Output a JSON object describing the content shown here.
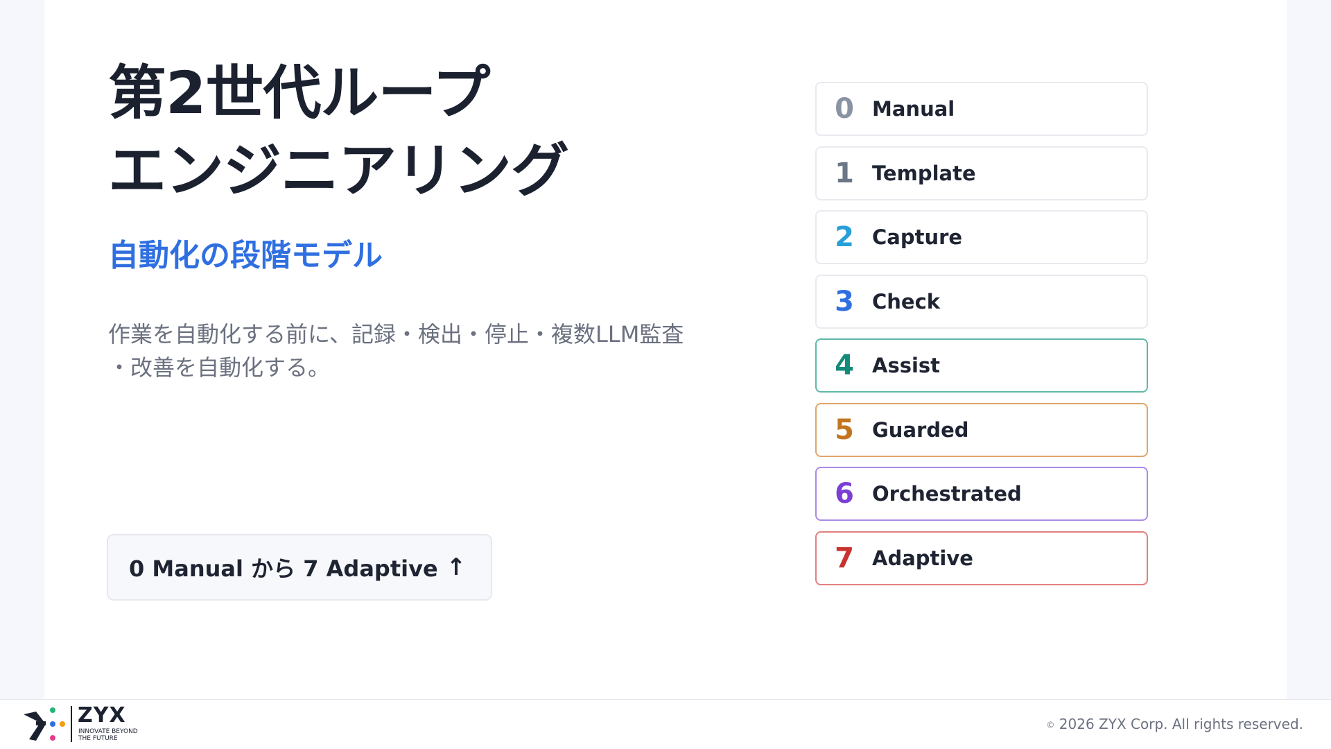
{
  "title": {
    "line1": "第2世代ループ",
    "line2": "エンジニアリング"
  },
  "subtitle": "自動化の段階モデル",
  "description": {
    "line1": "作業を自動化する前に、記録・検出・停止・複数LLM監査",
    "line2": "・改善を自動化する。"
  },
  "pill": {
    "text": "0 Manual から 7 Adaptive",
    "arrow": "↑"
  },
  "stages": [
    {
      "num": "0",
      "label": "Manual",
      "num_color": "#8a93a3",
      "border": "#e8eaef"
    },
    {
      "num": "1",
      "label": "Template",
      "num_color": "#6b7687",
      "border": "#e8eaef"
    },
    {
      "num": "2",
      "label": "Capture",
      "num_color": "#27a0d8",
      "border": "#e8eaef"
    },
    {
      "num": "3",
      "label": "Check",
      "num_color": "#2f6fe0",
      "border": "#e8eaef"
    },
    {
      "num": "4",
      "label": "Assist",
      "num_color": "#138a7a",
      "border": "#5fb8a8"
    },
    {
      "num": "5",
      "label": "Guarded",
      "num_color": "#c2751e",
      "border": "#e0a56a"
    },
    {
      "num": "6",
      "label": "Orchestrated",
      "num_color": "#7b3fd6",
      "border": "#a98ae6"
    },
    {
      "num": "7",
      "label": "Adaptive",
      "num_color": "#c8332f",
      "border": "#e08080"
    }
  ],
  "footer": {
    "logo_word": "ZYX",
    "logo_tag_line1": "INNOVATE BEYOND",
    "logo_tag_line2": "THE FUTURE",
    "copyright_symbol": "©",
    "copyright": "2026 ZYX Corp. All rights reserved."
  }
}
